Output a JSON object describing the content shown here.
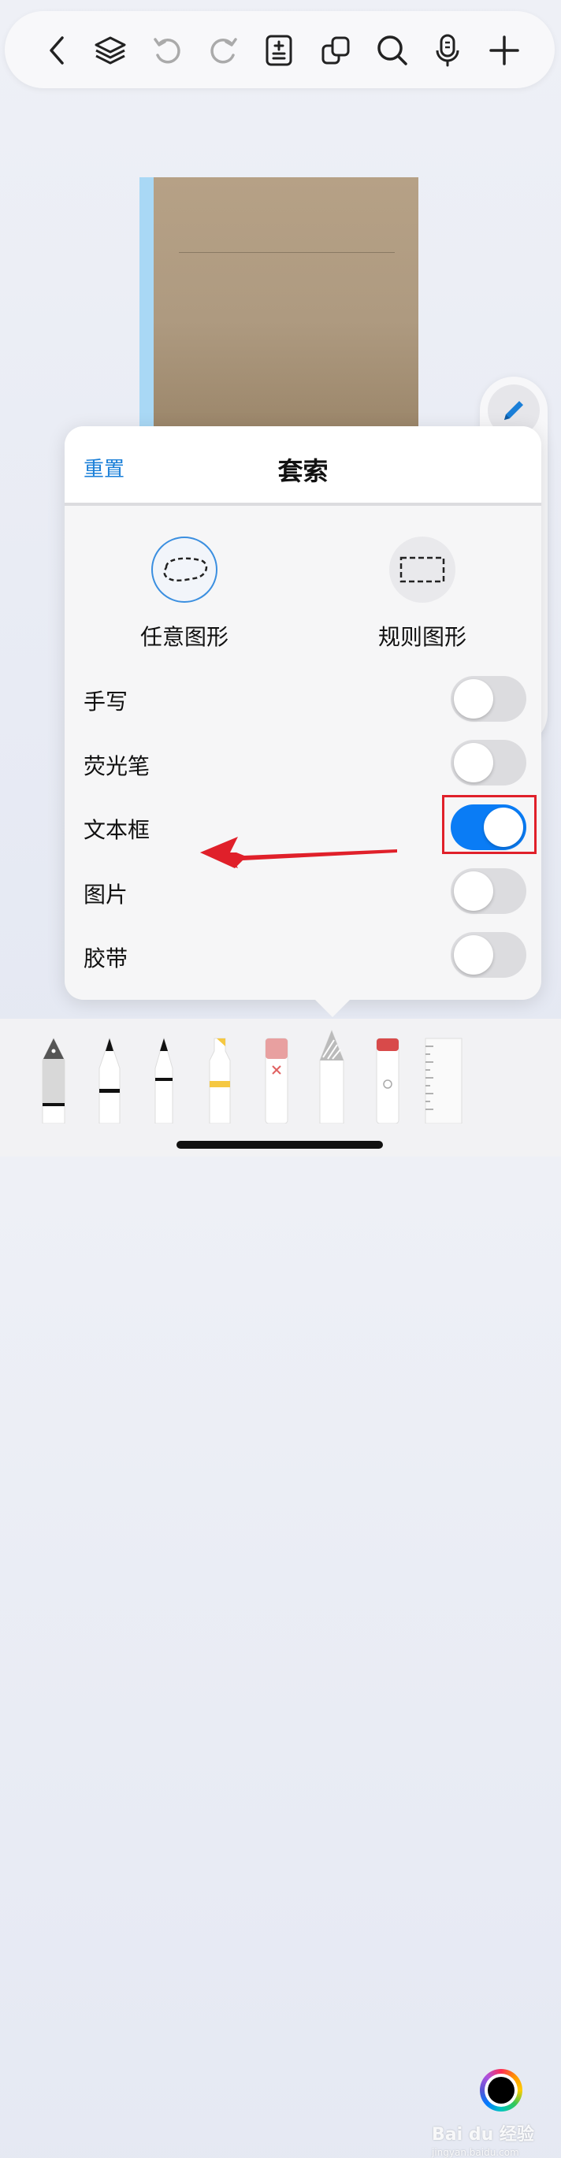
{
  "toolbar": {
    "icons": [
      "back-icon",
      "layers-icon",
      "undo-icon",
      "redo-icon",
      "page-adjust-icon",
      "copy-icon",
      "search-icon",
      "microphone-icon",
      "plus-icon"
    ]
  },
  "lasso_popup": {
    "reset_label": "重置",
    "title": "套索",
    "shapes": [
      {
        "label": "任意图形",
        "selected": true
      },
      {
        "label": "规则图形",
        "selected": false
      }
    ],
    "options": [
      {
        "label": "手写",
        "on": false
      },
      {
        "label": "荧光笔",
        "on": false
      },
      {
        "label": "文本框",
        "on": true
      },
      {
        "label": "图片",
        "on": false
      },
      {
        "label": "胶带",
        "on": false
      }
    ]
  },
  "tools": [
    "fountain-pen",
    "ballpoint-pen",
    "pencil",
    "highlighter",
    "eraser",
    "lasso-tool",
    "tape",
    "ruler"
  ],
  "colors": {
    "accent": "#0a7cf5",
    "annotation": "#e0202a",
    "selected_color": "#000000"
  },
  "watermark": {
    "text": "Bai du 经验",
    "sub": "jingyan.baidu.com"
  }
}
